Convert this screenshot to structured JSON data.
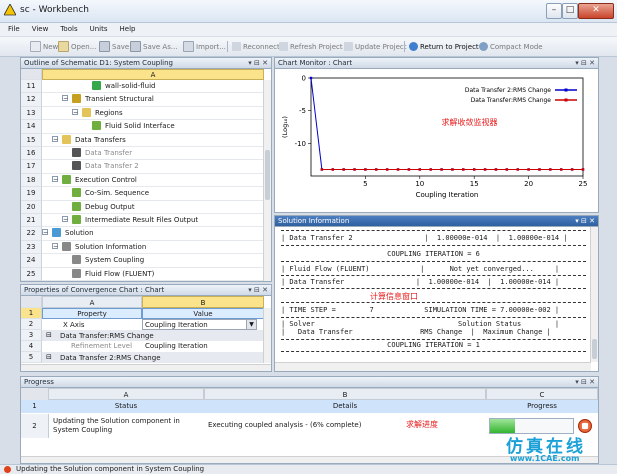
{
  "window": {
    "title": "sc - Workbench"
  },
  "menu": [
    "File",
    "View",
    "Tools",
    "Units",
    "Help"
  ],
  "toolbar": {
    "new": "New",
    "open": "Open...",
    "save": "Save",
    "save_as": "Save As...",
    "import": "Import...",
    "reconnect": "Reconnect",
    "refresh": "Refresh Project",
    "update": "Update Project",
    "return": "Return to Project",
    "compact": "Compact Mode"
  },
  "outline": {
    "header": "Outline of Schematic D1: System Coupling",
    "column": "A",
    "rows": [
      {
        "num": "11",
        "label": "wall-solid-fluid",
        "indent": 4
      },
      {
        "num": "12",
        "label": "Transient Structural",
        "indent": 2
      },
      {
        "num": "13",
        "label": "Regions",
        "indent": 3
      },
      {
        "num": "14",
        "label": "Fluid Solid Interface",
        "indent": 4
      },
      {
        "num": "15",
        "label": "Data Transfers",
        "indent": 1
      },
      {
        "num": "16",
        "label": "Data Transfer",
        "indent": 2
      },
      {
        "num": "17",
        "label": "Data Transfer 2",
        "indent": 2
      },
      {
        "num": "18",
        "label": "Execution Control",
        "indent": 1
      },
      {
        "num": "19",
        "label": "Co-Sim. Sequence",
        "indent": 2
      },
      {
        "num": "20",
        "label": "Debug Output",
        "indent": 2
      },
      {
        "num": "21",
        "label": "Intermediate Result Files Output",
        "indent": 2
      },
      {
        "num": "22",
        "label": "Solution",
        "indent": 0
      },
      {
        "num": "23",
        "label": "Solution Information",
        "indent": 1
      },
      {
        "num": "24",
        "label": "System Coupling",
        "indent": 2
      },
      {
        "num": "25",
        "label": "Fluid Flow (FLUENT)",
        "indent": 2
      }
    ]
  },
  "properties": {
    "header": "Properties of Convergence Chart : Chart",
    "col_a": "A",
    "col_b": "B",
    "r1": {
      "num": "1",
      "a": "Property",
      "b": "Value"
    },
    "r2": {
      "num": "2",
      "a": "X Axis",
      "b": "Coupling Iteration"
    },
    "r3": {
      "num": "3",
      "a": "Data Transfer:RMS Change"
    },
    "r4": {
      "num": "4",
      "a": "Refinement Level",
      "b": "Coupling Iteration"
    },
    "r5": {
      "num": "5",
      "a": "Data Transfer 2:RMS Change"
    }
  },
  "chart_panel": {
    "header": "Chart Monitor : Chart",
    "annotation": "求解收敛监视器"
  },
  "chart_data": {
    "type": "line",
    "xlabel": "Coupling Iteration",
    "ylabel": "(Log₁₀)",
    "xlim": [
      0,
      25
    ],
    "ylim": [
      -15,
      0
    ],
    "xticks": [
      "5",
      "10",
      "15",
      "20",
      "25"
    ],
    "yticks": [
      "0",
      "-5",
      "-10"
    ],
    "legend_position": "top-right",
    "series": [
      {
        "name": "Data Transfer 2:RMS Change",
        "color": "#0000cc",
        "x": [
          0,
          1,
          2,
          3,
          4,
          5,
          6,
          7,
          8,
          9,
          10,
          11,
          12,
          13,
          14,
          15,
          16,
          17,
          18,
          19,
          20,
          21,
          22,
          23,
          24,
          25
        ],
        "y": [
          0,
          -14,
          -14,
          -14,
          -14,
          -14,
          -14,
          -14,
          -14,
          -14,
          -14,
          -14,
          -14,
          -14,
          -14,
          -14,
          -14,
          -14,
          -14,
          -14,
          -14,
          -14,
          -14,
          -14,
          -14,
          -14
        ]
      },
      {
        "name": "Data Transfer:RMS Change",
        "color": "#cc0000",
        "x": [
          1,
          2,
          3,
          4,
          5,
          6,
          7,
          8,
          9,
          10,
          11,
          12,
          13,
          14,
          15,
          16,
          17,
          18,
          19,
          20,
          21,
          22,
          23,
          24,
          25
        ],
        "y": [
          -14,
          -14,
          -14,
          -14,
          -14,
          -14,
          -14,
          -14,
          -14,
          -14,
          -14,
          -14,
          -14,
          -14,
          -14,
          -14,
          -14,
          -14,
          -14,
          -14,
          -14,
          -14,
          -14,
          -14,
          -14
        ]
      }
    ]
  },
  "solution": {
    "header": "Solution Information",
    "l1": "| Data Transfer 2                 |  1.00000e-014  |  1.00000e-014 |",
    "l2": "COUPLING ITERATION = 6",
    "l3": "| Fluid Flow (FLUENT)            |      Not yet converged...     |",
    "l4": "| Data Transfer                 |  1.00000e-014  |  1.00000e-014 |",
    "annotation": "计算信息窗口",
    "l5": "| TIME STEP =        7            SIMULATION TIME = 7.00000e-002 |",
    "l6": "| Solver                                  Solution Status        |",
    "l7": "|   Data Transfer                RMS Change  |  Maximum Change |",
    "l8": "COUPLING ITERATION = 1"
  },
  "progress": {
    "header": "Progress",
    "col_a": "A",
    "col_b": "B",
    "col_c": "C",
    "h_num": "1",
    "h_status": "Status",
    "h_details": "Details",
    "h_progress": "Progress",
    "row_num": "2",
    "status": "Updating the Solution component in System Coupling",
    "details": "Executing coupled analysis - (6% complete)",
    "annotation": "求解进度",
    "percent": 6
  },
  "statusbar": {
    "text": "Updating the Solution component in System Coupling"
  },
  "watermark": {
    "text": "仿真在线",
    "url": "www.1CAE.com"
  }
}
